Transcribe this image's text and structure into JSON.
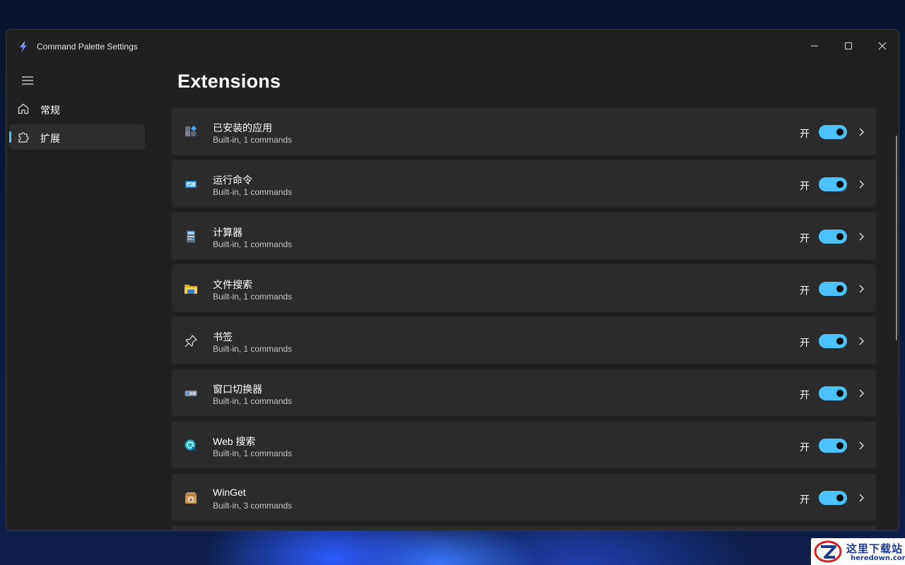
{
  "window": {
    "title": "Command Palette Settings",
    "icon": "lightning-bolt-icon",
    "controls": [
      "minimize-icon",
      "maximize-icon",
      "close-icon"
    ]
  },
  "sidebar": {
    "menu_icon": "hamburger-menu-icon",
    "items": [
      {
        "label": "常规",
        "icon": "home-icon",
        "selected": false
      },
      {
        "label": "扩展",
        "icon": "puzzle-icon",
        "selected": true
      }
    ]
  },
  "page": {
    "title": "Extensions"
  },
  "extensions": [
    {
      "name": "已安装的应用",
      "subtitle": "Built-in, 1 commands",
      "state": "开",
      "enabled": true,
      "icon": "installed-apps-icon"
    },
    {
      "name": "运行命令",
      "subtitle": "Built-in, 1 commands",
      "state": "开",
      "enabled": true,
      "icon": "run-command-icon"
    },
    {
      "name": "计算器",
      "subtitle": "Built-in, 1 commands",
      "state": "开",
      "enabled": true,
      "icon": "calculator-icon"
    },
    {
      "name": "文件搜索",
      "subtitle": "Built-in, 1 commands",
      "state": "开",
      "enabled": true,
      "icon": "folder-icon"
    },
    {
      "name": "书签",
      "subtitle": "Built-in, 1 commands",
      "state": "开",
      "enabled": true,
      "icon": "pin-icon"
    },
    {
      "name": "窗口切换器",
      "subtitle": "Built-in, 1 commands",
      "state": "开",
      "enabled": true,
      "icon": "window-switcher-icon"
    },
    {
      "name": "Web 搜索",
      "subtitle": "Built-in, 1 commands",
      "state": "开",
      "enabled": true,
      "icon": "web-search-icon"
    },
    {
      "name": "WinGet",
      "subtitle": "Built-in, 3 commands",
      "state": "开",
      "enabled": true,
      "icon": "winget-package-icon"
    }
  ],
  "watermark": {
    "title": "这里下载站",
    "url": "heredown.com"
  },
  "colors": {
    "accent": "#4cc2ff",
    "window_bg": "#202020",
    "card_bg": "#2b2b2b"
  }
}
